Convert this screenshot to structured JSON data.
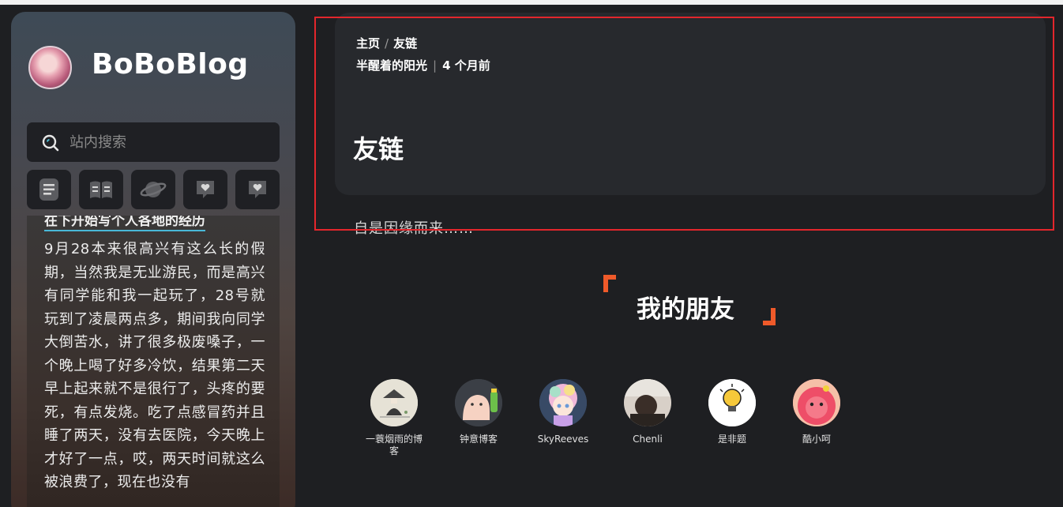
{
  "sidebar": {
    "brand": "BoBoBlog",
    "search_placeholder": "站内搜索",
    "icons": [
      "document-icon",
      "book-icon",
      "planet-icon",
      "heart-chat-icon",
      "heart-chat-icon"
    ],
    "post_heading": "在下开始写个人各地的经历",
    "post_text": "9月28本来很高兴有这么长的假期，当然我是无业游民，而是高兴有同学能和我一起玩了，28号就玩到了凌晨两点多，期间我向同学大倒苦水，讲了很多极废嗓子，一个晚上喝了好多冷饮，结果第二天早上起来就不是很行了，头疼的要死，有点发烧。吃了点感冒药并且睡了两天，没有去医院，今天晚上才好了一点，哎，两天时间就这么被浪费了，现在也没有"
  },
  "header": {
    "breadcrumb_home": "主页",
    "breadcrumb_sep": "/",
    "breadcrumb_current": "友链",
    "author": "半醒着的阳光",
    "meta_sep": "|",
    "time": "4 个月前",
    "title": "友链"
  },
  "intro": "自是因缘而来……",
  "friends_section": {
    "title": "我的朋友",
    "accent": "#ef5a2a",
    "friends": [
      {
        "name": "一蓑烟雨的博客"
      },
      {
        "name": "钟意博客"
      },
      {
        "name": "SkyReeves"
      },
      {
        "name": "Chenli"
      },
      {
        "name": "是非题"
      },
      {
        "name": "酷小呵"
      }
    ]
  }
}
